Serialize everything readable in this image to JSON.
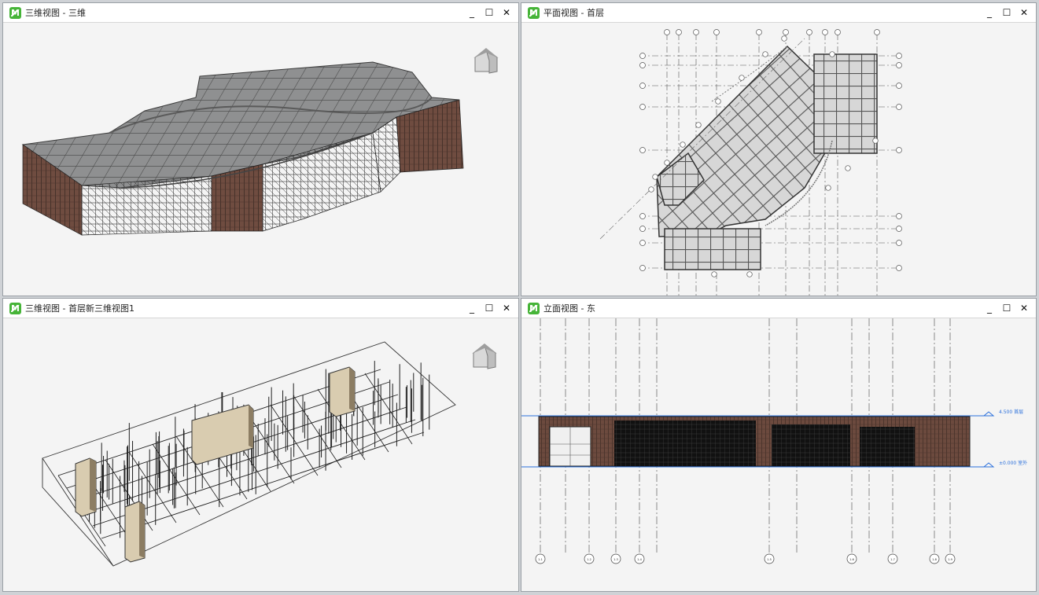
{
  "panes": [
    {
      "title": "三维视图 - 三维"
    },
    {
      "title": "平面视图 - 首层"
    },
    {
      "title": "三维视图 - 首层新三维视图1"
    },
    {
      "title": "立面视图 - 东"
    }
  ],
  "controls": {
    "minimize": "_",
    "maximize": "☐",
    "close": "✕"
  },
  "icons": {
    "app_logo": "M",
    "view_cube": "house-icon"
  },
  "elevation": {
    "level_top": "4.500 首层",
    "level_bottom": "±0.000 室外",
    "grid_labels": [
      "1-1",
      "1-2",
      "1-3",
      "1-4",
      "1-5",
      "1-6",
      "1-7",
      "1-8",
      "1-9"
    ]
  },
  "colors": {
    "accent_green": "#46b438",
    "level_blue": "#2a6fdb",
    "brick": "#7a5546"
  }
}
